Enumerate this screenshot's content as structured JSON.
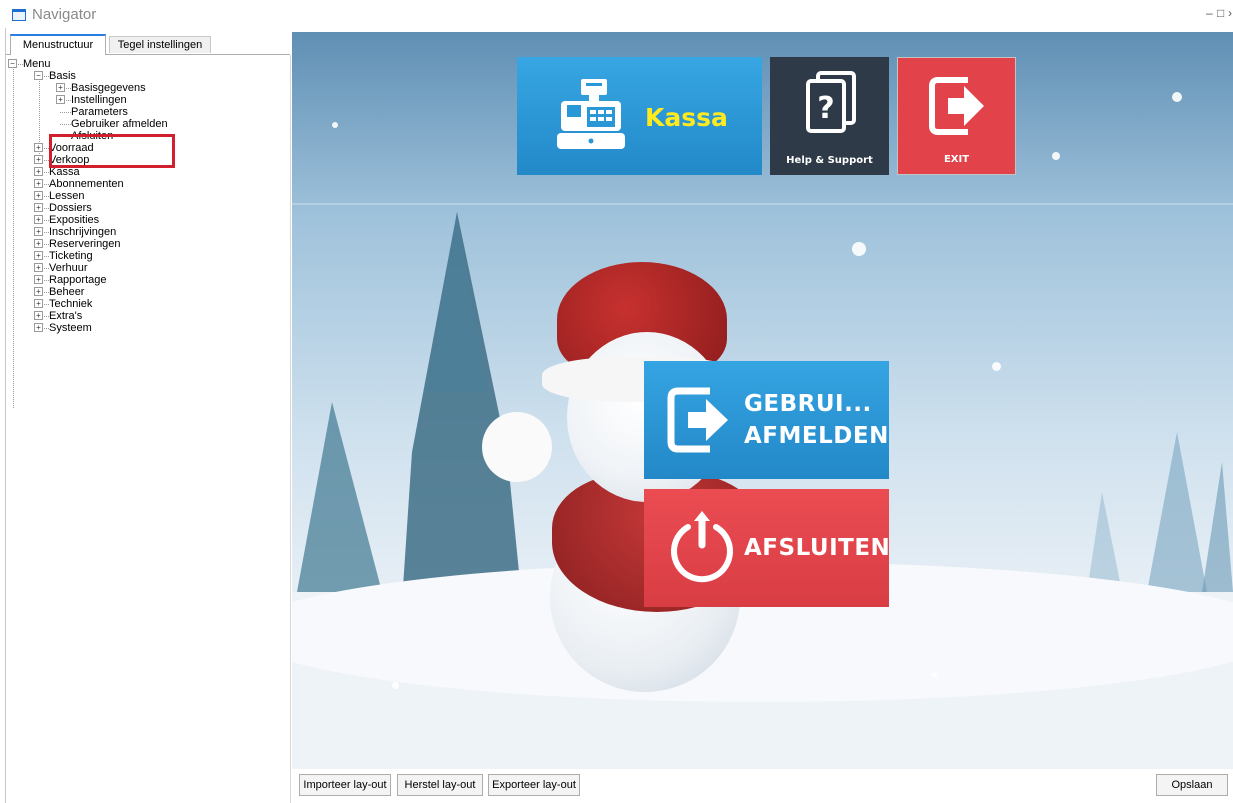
{
  "window": {
    "title": "Navigator"
  },
  "tabs": [
    {
      "label": "Menustructuur"
    },
    {
      "label": "Tegel instellingen"
    }
  ],
  "tree": {
    "root": "Menu",
    "basis": {
      "label": "Basis",
      "children": [
        "Basisgegevens",
        "Instellingen",
        "Parameters",
        "Gebruiker afmelden",
        "Afsluiten"
      ]
    },
    "items": [
      "Voorraad",
      "Verkoop",
      "Kassa",
      "Abonnementen",
      "Lessen",
      "Dossiers",
      "Exposities",
      "Inschrijvingen",
      "Reserveringen",
      "Ticketing",
      "Verhuur",
      "Rapportage",
      "Beheer",
      "Techniek",
      "Extra's",
      "Systeem"
    ]
  },
  "tiles": {
    "kassa": {
      "label": "Kassa",
      "icon": "cash-register-icon",
      "color": "#2a97d6",
      "label_color": "#ffea1f"
    },
    "help": {
      "label": "Help & Support",
      "icon": "help-documents-icon",
      "color": "#2f3a48"
    },
    "exit": {
      "label": "EXIT",
      "icon": "exit-door-icon",
      "color": "#e2434b"
    },
    "logout": {
      "line1": "GEBRUI...",
      "line2": "AFMELDEN",
      "icon": "logout-door-icon",
      "color": "#2a97d6"
    },
    "quit": {
      "label": "AFSLUITEN",
      "icon": "power-icon",
      "color": "#e2434b"
    }
  },
  "buttons": {
    "import": "Importeer lay-out",
    "reset": "Herstel lay-out",
    "export": "Exporteer lay-out",
    "save": "Opslaan"
  },
  "highlight_color": "#d21f2e"
}
